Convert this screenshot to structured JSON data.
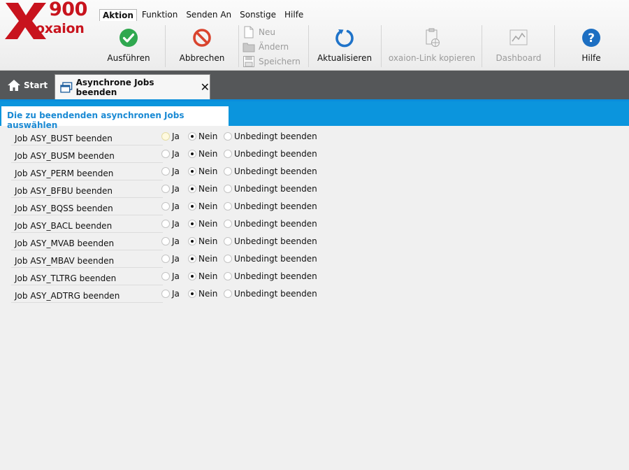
{
  "logo": {
    "number": "900",
    "name": "oxaion"
  },
  "menu": [
    {
      "label": "Aktion",
      "active": true
    },
    {
      "label": "Funktion",
      "active": false
    },
    {
      "label": "Senden An",
      "active": false
    },
    {
      "label": "Sonstige",
      "active": false
    },
    {
      "label": "Hilfe",
      "active": false
    }
  ],
  "toolbar": {
    "execute": "Ausführen",
    "cancel": "Abbrechen",
    "new": "Neu",
    "change": "Ändern",
    "save": "Speichern",
    "refresh": "Aktualisieren",
    "copy_link": "oxaion-Link kopieren",
    "dashboard": "Dashboard",
    "help": "Hilfe",
    "icons": {
      "execute": "checkmark-icon",
      "cancel": "no-entry-icon",
      "refresh": "refresh-icon",
      "copy_link": "clipboard-globe-icon",
      "dashboard": "line-chart-icon",
      "help": "question-icon"
    }
  },
  "tabs": {
    "home": "Start",
    "active": "Asynchrone Jobs beenden",
    "close": "✕"
  },
  "section": {
    "title": "Die zu beendenden asynchronen Jobs auswählen"
  },
  "options": {
    "yes": "Ja",
    "no": "Nein",
    "force": "Unbedingt beenden"
  },
  "jobs": [
    {
      "label": "Job ASY_BUST beenden",
      "selected": "Nein"
    },
    {
      "label": "Job ASY_BUSM beenden",
      "selected": "Nein"
    },
    {
      "label": "Job ASY_PERM beenden",
      "selected": "Nein"
    },
    {
      "label": "Job ASY_BFBU beenden",
      "selected": "Nein"
    },
    {
      "label": "Job ASY_BQSS beenden",
      "selected": "Nein"
    },
    {
      "label": "Job ASY_BACL beenden",
      "selected": "Nein"
    },
    {
      "label": "Job ASY_MVAB beenden",
      "selected": "Nein"
    },
    {
      "label": "Job ASY_MBAV beenden",
      "selected": "Nein"
    },
    {
      "label": "Job ASY_TLTRG beenden",
      "selected": "Nein"
    },
    {
      "label": "Job ASY_ADTRG beenden",
      "selected": "Nein"
    }
  ],
  "colors": {
    "brand_red": "#c8131d",
    "accent_blue": "#0b95dd",
    "execute_green": "#2fa84f",
    "tab_bar": "#555759"
  }
}
